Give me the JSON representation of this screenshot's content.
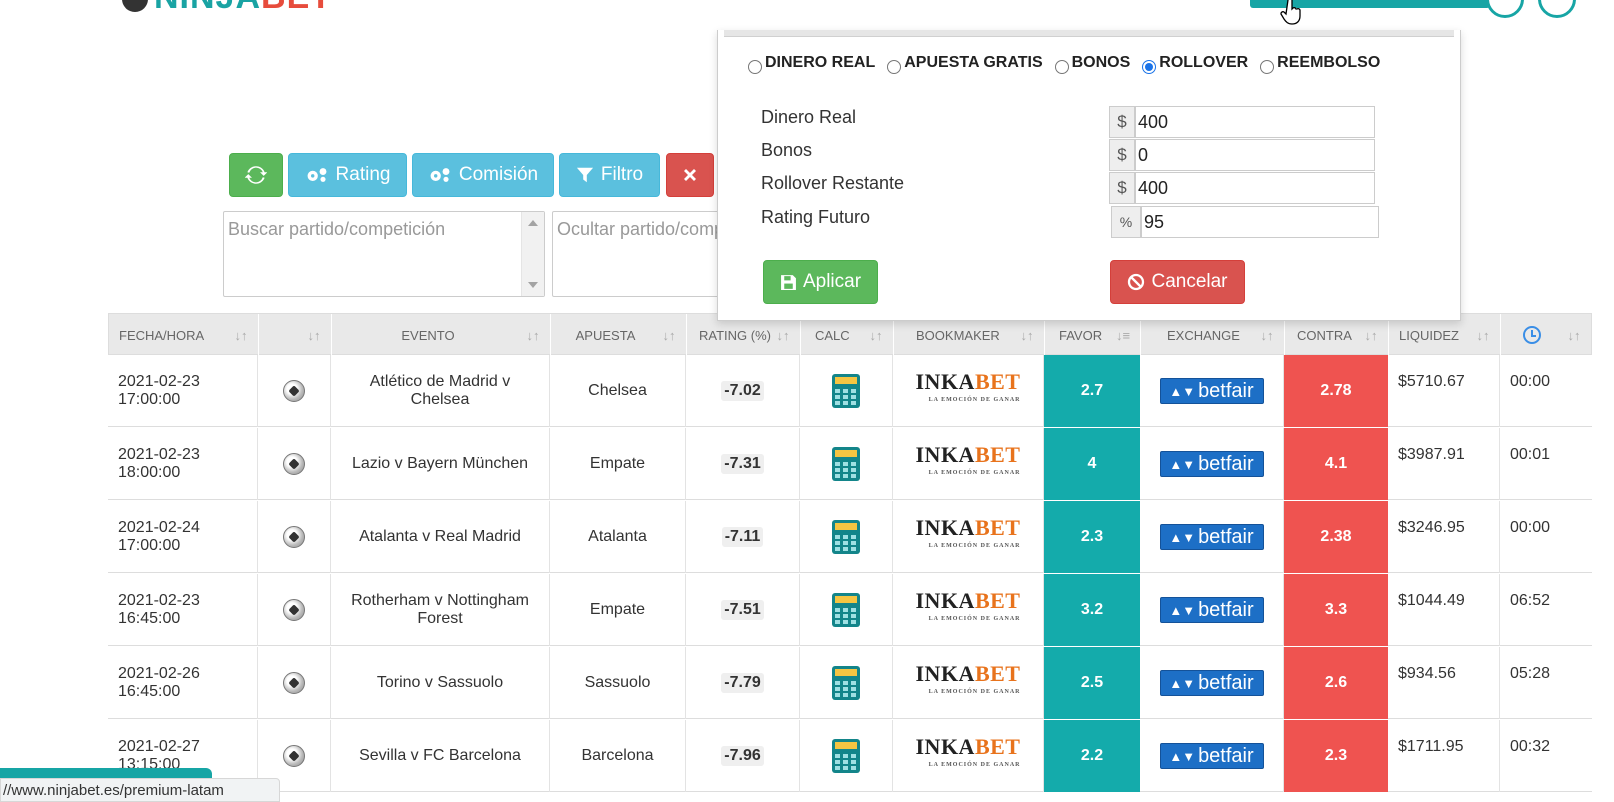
{
  "header": {
    "logo_text": "NINJABET",
    "logo_part1": "NINJA",
    "logo_part2": "BET"
  },
  "toolbar": {
    "rating_label": "Rating",
    "comision_label": "Comisión",
    "filtro_label": "Filtro"
  },
  "search": {
    "buscar_placeholder": "Buscar partido/competición",
    "ocultar_placeholder": "Ocultar partido/competición"
  },
  "modal": {
    "radios": [
      {
        "label": "DINERO REAL",
        "selected": false
      },
      {
        "label": "APUESTA GRATIS",
        "selected": false
      },
      {
        "label": "BONOS",
        "selected": false
      },
      {
        "label": "ROLLOVER",
        "selected": true
      },
      {
        "label": "REEMBOLSO",
        "selected": false
      }
    ],
    "fields": [
      {
        "label": "Dinero Real",
        "addon": "$",
        "value": "400"
      },
      {
        "label": "Bonos",
        "addon": "$",
        "value": "0"
      },
      {
        "label": "Rollover Restante",
        "addon": "$",
        "value": "400"
      },
      {
        "label": "Rating Futuro",
        "addon": "%",
        "value": "95"
      }
    ],
    "apply_label": "Aplicar",
    "cancel_label": "Cancelar"
  },
  "table": {
    "headers": [
      "FECHA/HORA",
      "",
      "EVENTO",
      "APUESTA",
      "RATING (%)",
      "CALC",
      "BOOKMAKER",
      "FAVOR",
      "EXCHANGE",
      "CONTRA",
      "LIQUIDEZ",
      ""
    ],
    "rows": [
      {
        "date": "2021-02-23",
        "time": "17:00:00",
        "event": "Atlético de Madrid v Chelsea",
        "bet": "Chelsea",
        "rating": "-7.02",
        "favor": "2.7",
        "contra": "2.78",
        "liquidez": "$5710.67",
        "timer": "00:00"
      },
      {
        "date": "2021-02-23",
        "time": "18:00:00",
        "event": "Lazio v Bayern München",
        "bet": "Empate",
        "rating": "-7.31",
        "favor": "4",
        "contra": "4.1",
        "liquidez": "$3987.91",
        "timer": "00:01"
      },
      {
        "date": "2021-02-24",
        "time": "17:00:00",
        "event": "Atalanta v Real Madrid",
        "bet": "Atalanta",
        "rating": "-7.11",
        "favor": "2.3",
        "contra": "2.38",
        "liquidez": "$3246.95",
        "timer": "00:00"
      },
      {
        "date": "2021-02-23",
        "time": "16:45:00",
        "event": "Rotherham v Nottingham Forest",
        "bet": "Empate",
        "rating": "-7.51",
        "favor": "3.2",
        "contra": "3.3",
        "liquidez": "$1044.49",
        "timer": "06:52"
      },
      {
        "date": "2021-02-26",
        "time": "16:45:00",
        "event": "Torino v Sassuolo",
        "bet": "Sassuolo",
        "rating": "-7.79",
        "favor": "2.5",
        "contra": "2.6",
        "liquidez": "$934.56",
        "timer": "05:28"
      },
      {
        "date": "2021-02-27",
        "time": "13:15:00",
        "event": "Sevilla v FC Barcelona",
        "bet": "Barcelona",
        "rating": "-7.96",
        "favor": "2.2",
        "contra": "2.3",
        "liquidez": "$1711.95",
        "timer": "00:32"
      }
    ],
    "bookmaker_text": "INKABET",
    "bookmaker_part1": "INKA",
    "bookmaker_part2": "BET",
    "bookmaker_tagline": "LA EMOCIÓN DE GANAR",
    "exchange_text": "betfair"
  },
  "statusbar": {
    "url": "//www.ninjabet.es/premium-latam"
  },
  "icons": {
    "refresh": "refresh-icon",
    "cogs": "cogs-icon",
    "filter": "filter-icon",
    "close": "close-icon",
    "save": "save-icon",
    "ban": "ban-icon",
    "clock": "clock-icon",
    "sort": "sort-icon",
    "ball": "soccer-ball-icon",
    "calculator": "calculator-icon"
  },
  "colors": {
    "favor": "#14abab",
    "contra": "#ef5350",
    "green": "#5cb85c",
    "blue": "#5bc0de",
    "red": "#d9534f"
  }
}
